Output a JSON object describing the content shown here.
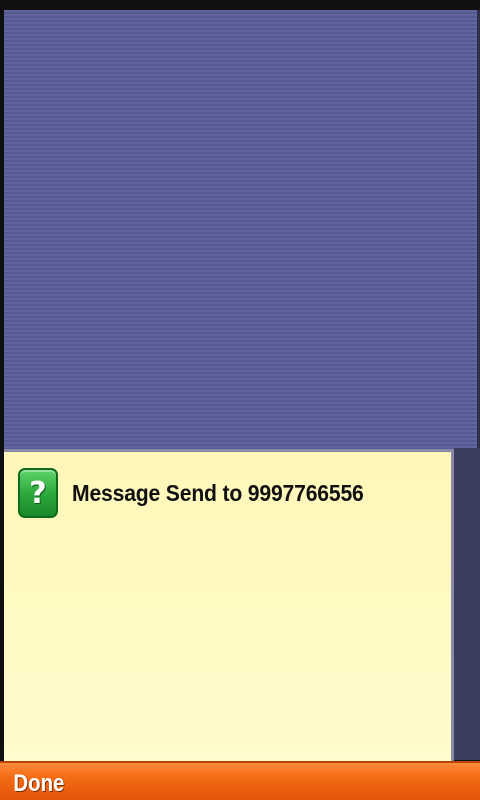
{
  "dialog": {
    "icon": "question-icon",
    "icon_glyph": "?",
    "message": "Message Send to 9997766556"
  },
  "softkeys": {
    "left_label": "Done"
  },
  "colors": {
    "backdrop": "#5a5f9a",
    "dialog_background": "#fff9c0",
    "softkey_bar": "#f36b13",
    "icon_green": "#2aa63a"
  }
}
